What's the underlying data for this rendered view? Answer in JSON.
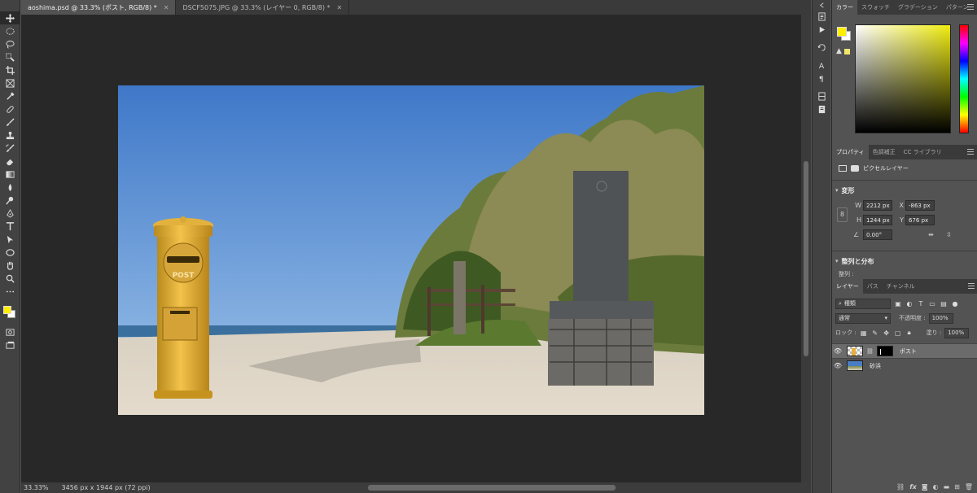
{
  "document_tabs": [
    {
      "label": "aoshima.psd @ 33.3% (ポスト, RGB/8) *",
      "active": true
    },
    {
      "label": "DSCF5075.JPG @ 33.3% (レイヤー 0, RGB/8) *",
      "active": false
    }
  ],
  "toolbar": {
    "tools": [
      "move-icon",
      "marquee-icon",
      "lasso-icon",
      "quick-select-icon",
      "crop-icon",
      "frame-icon",
      "eyedropper-icon",
      "healing-brush-icon",
      "brush-icon",
      "clone-stamp-icon",
      "history-brush-icon",
      "eraser-icon",
      "gradient-icon",
      "blur-icon",
      "dodge-icon",
      "pen-icon",
      "type-icon",
      "path-select-icon",
      "ellipse-icon",
      "hand-icon",
      "zoom-icon",
      "more-icon"
    ],
    "foreground_color": "#ffee00",
    "background_color": "#ffffff"
  },
  "status": {
    "zoom": "33.33%",
    "doc_info": "3456 px x 1944 px (72 ppi)"
  },
  "color_panel": {
    "tabs": [
      "カラー",
      "スウォッチ",
      "グラデーション",
      "パターン"
    ],
    "active_tab": "カラー",
    "foreground_color": "#ffee00"
  },
  "properties_panel": {
    "tabs": [
      "プロパティ",
      "色調補正",
      "CC ライブラリ"
    ],
    "layer_type": "ピクセルレイヤー",
    "transform_title": "変形",
    "w_label": "W",
    "w_value": "2212 px",
    "x_label": "X",
    "x_value": "-863 px",
    "h_label": "H",
    "h_value": "1244 px",
    "y_label": "Y",
    "y_value": "676 px",
    "angle_value": "0.00°",
    "align_title": "整列と分布",
    "align_label": "整列 :"
  },
  "layers_panel": {
    "tabs": [
      "レイヤー",
      "パス",
      "チャンネル"
    ],
    "filter_placeholder": "種類",
    "blend_mode": "通常",
    "opacity_label": "不透明度 :",
    "opacity_value": "100%",
    "lock_label": "ロック :",
    "fill_label": "塗り :",
    "fill_value": "100%",
    "layers": [
      {
        "name": "ポスト",
        "visible": true,
        "selected": true,
        "has_mask": true
      },
      {
        "name": "砂浜",
        "visible": true,
        "selected": false,
        "has_mask": false
      }
    ],
    "footer_icons": [
      "link-icon",
      "fx-icon",
      "mask-icon",
      "adjustment-icon",
      "group-icon",
      "new-layer-icon",
      "trash-icon"
    ]
  }
}
